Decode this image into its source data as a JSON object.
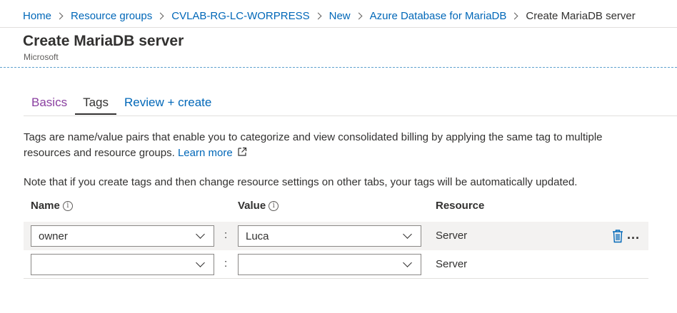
{
  "breadcrumb": {
    "items": [
      {
        "label": "Home"
      },
      {
        "label": "Resource groups"
      },
      {
        "label": "CVLAB-RG-LC-WORPRESS"
      },
      {
        "label": "New"
      },
      {
        "label": "Azure Database for MariaDB"
      }
    ],
    "current": "Create MariaDB server"
  },
  "page": {
    "title": "Create MariaDB server",
    "subtitle": "Microsoft"
  },
  "tabs": [
    {
      "label": "Basics",
      "state": "visited"
    },
    {
      "label": "Tags",
      "state": "active"
    },
    {
      "label": "Review + create",
      "state": "link"
    }
  ],
  "content": {
    "description": "Tags are name/value pairs that enable you to categorize and view consolidated billing by applying the same tag to multiple resources and resource groups.",
    "learn_more": "Learn more",
    "note": "Note that if you create tags and then change resource settings on other tabs, your tags will be automatically updated."
  },
  "table": {
    "headers": {
      "name": "Name",
      "value": "Value",
      "resource": "Resource"
    },
    "separator": ":",
    "rows": [
      {
        "name": "owner",
        "value": "Luca",
        "resource": "Server"
      },
      {
        "name": "",
        "value": "",
        "resource": "Server"
      }
    ],
    "more_label": "..."
  },
  "icons": {
    "info": "i",
    "trash": "trash-icon",
    "external": "external-link-icon"
  },
  "colors": {
    "link": "#0067b8",
    "visited_tab": "#8a3fa0",
    "row_highlight": "#f3f2f1",
    "dashed_rule": "#5fa2cf",
    "trash": "#0067b8"
  }
}
